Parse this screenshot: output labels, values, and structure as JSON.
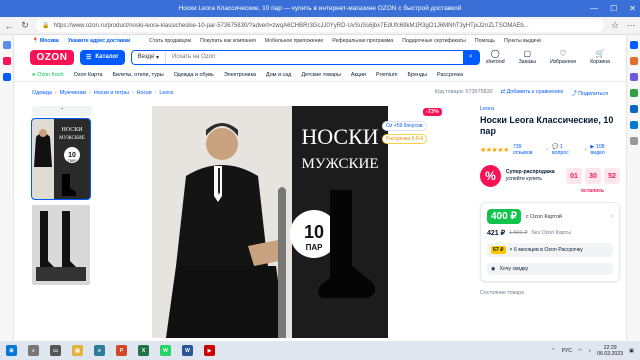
{
  "window": {
    "title": "Носки Leora Классические, 10 пар — купить в интернет-магазине OZON с быстрой доставкой"
  },
  "browser": {
    "url": "https://www.ozon.ru/product/noski-leora-klassicheskie-10-par-573675830/?advert=zwqA6CHBRr3GcJJ0YyRD-UvSuSs6jbx7EdUfc69kM1R3gO1J6MNhT3yHTjxJ2rrZLTSOMAEb..."
  },
  "toplinks": {
    "location": "Москва",
    "address_hint": "Укажите адрес доставки",
    "items": [
      "Стать продавцом",
      "Покупать как компания",
      "Мобильное приложение",
      "Реферальная программа",
      "Подарочные сертификаты",
      "Помощь",
      "Пункты выдачи"
    ]
  },
  "header": {
    "logo": "OZON",
    "catalog": "Каталог",
    "search_scope": "Везде",
    "search_placeholder": "Искать на Ozon",
    "icons": [
      {
        "label": "sherood",
        "icon": "user-icon"
      },
      {
        "label": "Заказы",
        "icon": "box-icon"
      },
      {
        "label": "Избранное",
        "icon": "heart-icon"
      },
      {
        "label": "Корзина",
        "icon": "cart-icon"
      }
    ]
  },
  "menu": {
    "items": [
      "Ozon fresh",
      "Ozon Карта",
      "Билеты, отели, туры",
      "Одежда и обувь",
      "Электроника",
      "Дом и сад",
      "Детские товары",
      "Акции",
      "Premium",
      "Бренды",
      "Рассрочка"
    ]
  },
  "breadcrumbs": {
    "items": [
      "Одежда",
      "Мужчинам",
      "Носки и гетры",
      "Носки",
      "Leora"
    ],
    "product_code": "Код товара: 573675830",
    "compare": "Добавить к сравнению",
    "share": "Поделиться"
  },
  "product": {
    "image_text_top": "НОСКИ",
    "image_text_bottom": "МУЖСКИЕ",
    "image_count": "10",
    "image_count_unit": "ПАР",
    "thumb_top_text": "НОСКИ",
    "thumb_bottom_text": "МУЖСКИЕ",
    "thumb_count": "10",
    "thumb_count_unit": "ПАР",
    "sale_badge": "-73%",
    "bonus_badge": "+59 бонусов",
    "installment_badge": "Рассрочка 0-0-6",
    "brand": "Leora",
    "title": "Носки Leora Классические, 10 пар",
    "stars": "★★★★★",
    "reviews": "739 отзывов",
    "questions": "1 вопрос",
    "videos": "108 видео"
  },
  "sale": {
    "percent": "%",
    "title": "Супер-распродажа",
    "subtitle": "успейте купить",
    "timer": [
      "01",
      "30",
      "52"
    ],
    "timer_label": "осталось"
  },
  "price": {
    "card_price": "400 ₽",
    "card_label": "с Ozon Картой",
    "regular_price": "421 ₽",
    "old_price": "1 590 ₽",
    "regular_label": "без Ozon Карты",
    "installment_amount": "67 ₽",
    "installment_text": "× 6 месяцев в Ozon Рассрочку",
    "want_discount": "Хочу скидку",
    "similar": "Состояние товара"
  },
  "taskbar": {
    "lang": "РУС",
    "time": "22:29",
    "date": "06.03.2023"
  },
  "colors": {
    "brand_blue": "#005bff",
    "brand_pink": "#f91155",
    "green": "#10c44c",
    "yellow": "#ffc600"
  }
}
